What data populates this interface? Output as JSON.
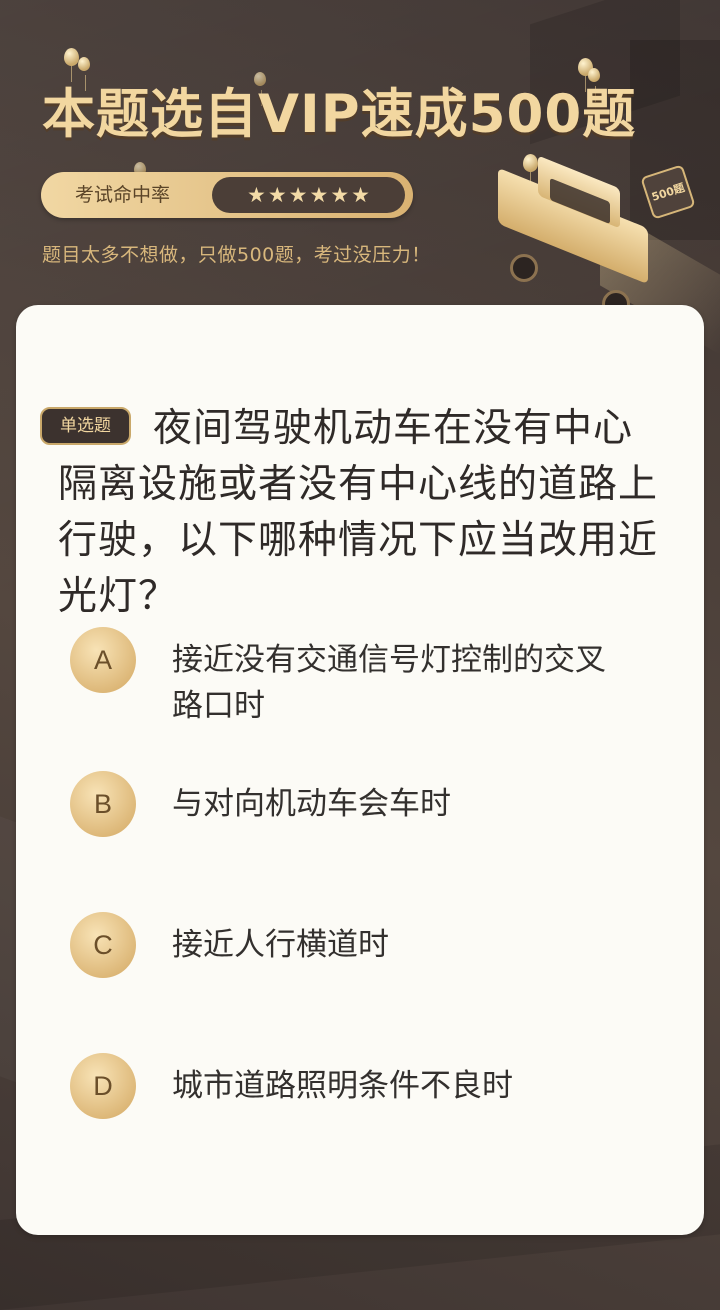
{
  "header": {
    "title": "本题选自VIP速成500题",
    "rate_label": "考试命中率",
    "stars": [
      "★",
      "★",
      "★",
      "★",
      "★",
      "★"
    ],
    "subtitle": "题目太多不想做，只做500题，考过没压力！",
    "badge_text": "500题"
  },
  "question": {
    "type_label": "单选题",
    "text": "夜间驾驶机动车在没有中心隔离设施或者没有中心线的道路上行驶，以下哪种情况下应当改用近光灯？"
  },
  "options": [
    {
      "letter": "A",
      "text": "接近没有交通信号灯控制的交叉路口时"
    },
    {
      "letter": "B",
      "text": "与对向机动车会车时"
    },
    {
      "letter": "C",
      "text": "接近人行横道时"
    },
    {
      "letter": "D",
      "text": "城市道路照明条件不良时"
    }
  ],
  "colors": {
    "background": "#4a3f3b",
    "gold": "#f2d7a0",
    "card": "#fcfbf6",
    "text": "#2f2a28"
  }
}
